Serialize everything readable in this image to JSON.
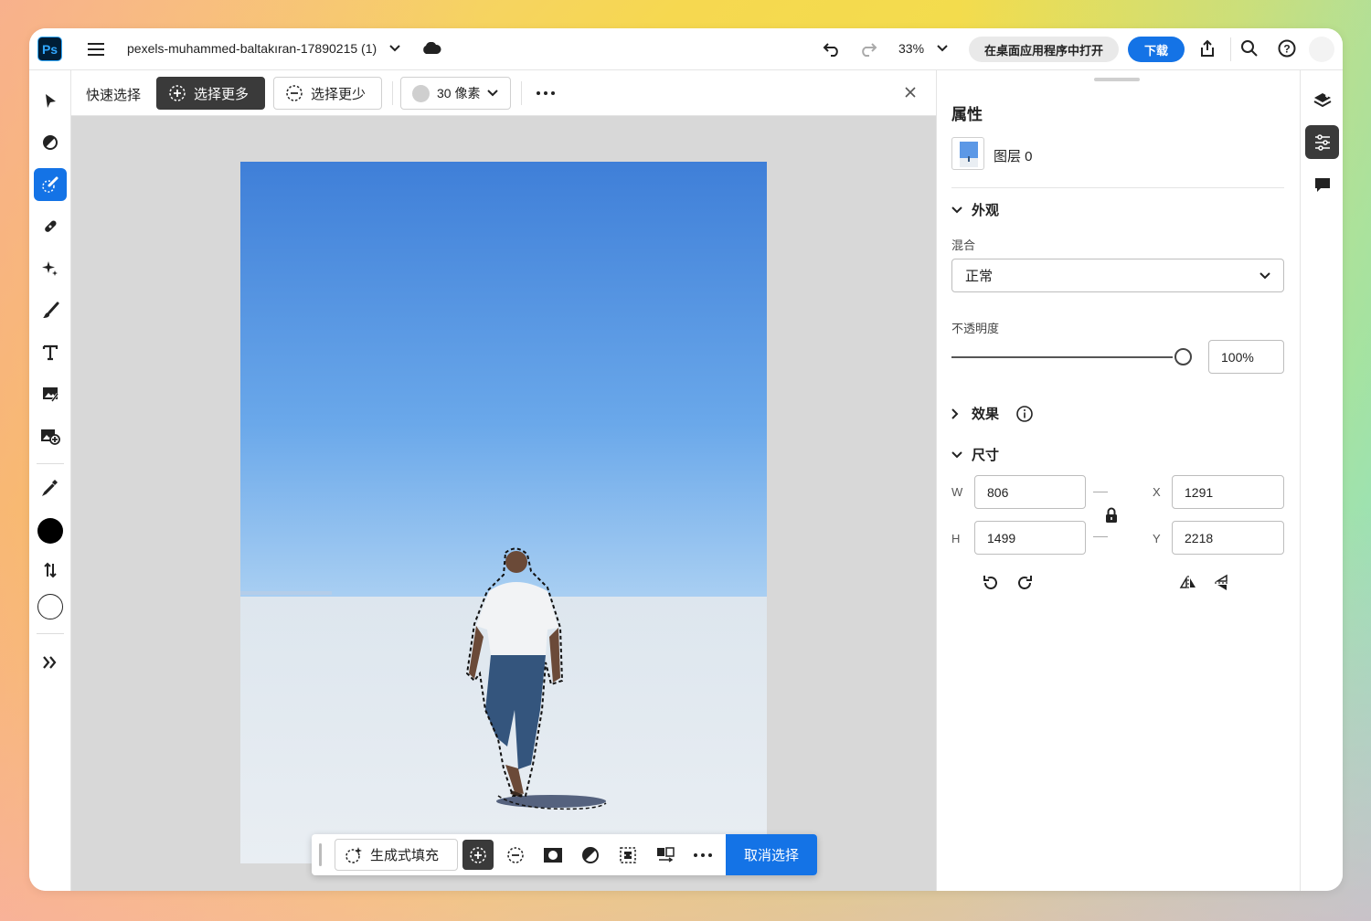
{
  "app": {
    "logo": "Ps",
    "filename": "pexels-muhammed-baltakıran-17890215 (1)"
  },
  "topbar": {
    "zoom": "33%",
    "open_desktop_label": "在桌面应用程序中打开",
    "download_label": "下载",
    "icons": [
      "menu-icon",
      "chevron-down-icon",
      "cloud-icon",
      "undo-icon",
      "redo-icon",
      "share-icon",
      "search-icon",
      "help-icon"
    ]
  },
  "options_bar": {
    "tool_name": "快速选择",
    "select_more_label": "选择更多",
    "select_less_label": "选择更少",
    "brush_size_label": "30 像素"
  },
  "left_tools": [
    "select-tool-icon",
    "adjust-tool-icon",
    "quick-select-tool-icon",
    "heal-tool-icon",
    "generative-tool-icon",
    "brush-tool-icon",
    "text-tool-icon",
    "place-image-icon",
    "add-image-icon",
    "eyedropper-icon",
    "foreground-color-swatch",
    "swap-colors-icon",
    "background-color-swatch",
    "more-tools-icon"
  ],
  "task_bar": {
    "generative_fill_label": "生成式填充",
    "deselect_label": "取消选择"
  },
  "properties": {
    "title": "属性",
    "layer_name": "图层 0",
    "appearance": {
      "header": "外观",
      "blend_label": "混合",
      "blend_value": "正常",
      "opacity_label": "不透明度",
      "opacity_value": "100%",
      "opacity_level": 1.0
    },
    "effects": {
      "header": "效果"
    },
    "size": {
      "header": "尺寸",
      "w_label": "W",
      "w_value": "806",
      "h_label": "H",
      "h_value": "1499",
      "x_label": "X",
      "x_value": "1291",
      "y_label": "Y",
      "y_value": "2218"
    }
  },
  "colors": {
    "accent": "#1473e6",
    "foreground": "#000000",
    "background": "#ffffff"
  }
}
